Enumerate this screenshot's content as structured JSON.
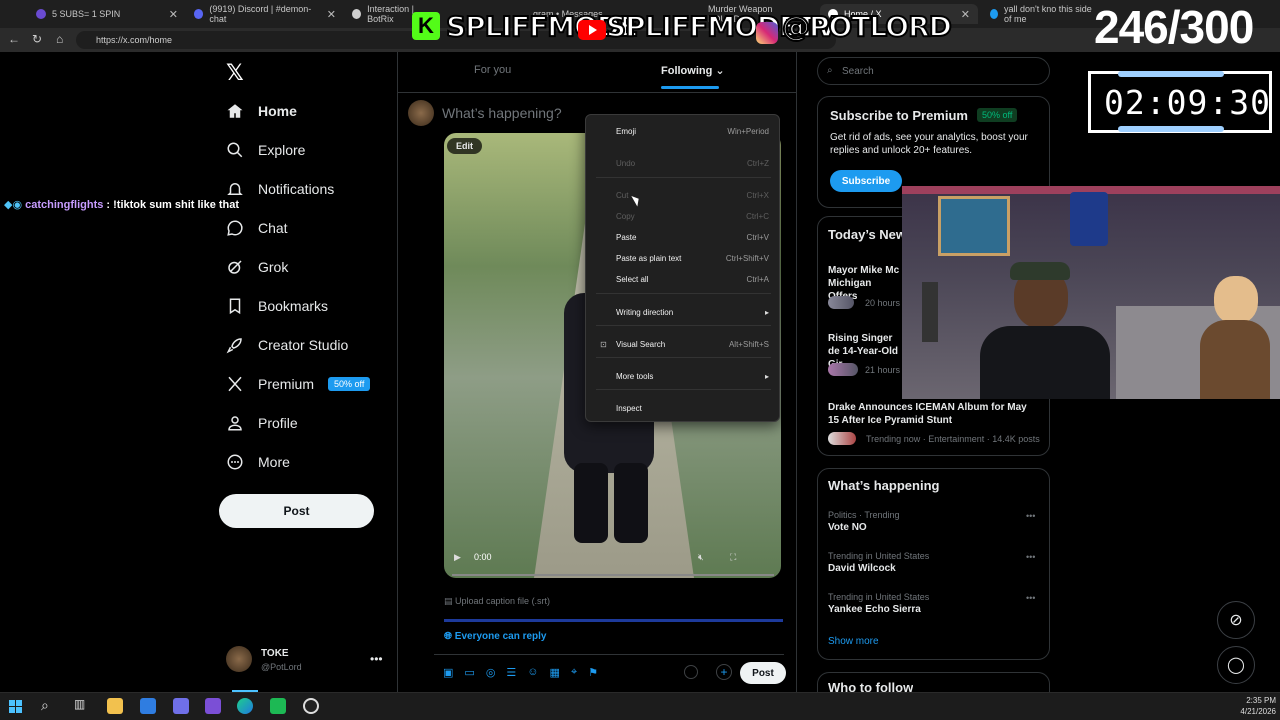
{
  "browser": {
    "tabs": [
      {
        "title": "5 SUBS= 1 SPIN",
        "fav_color": "#6a4bd1"
      },
      {
        "title": "(9919) Discord | #demon-chat",
        "fav_color": "#5865f2"
      },
      {
        "title": "Interaction | BotRix",
        "fav_color": "#cfcfcf"
      },
      {
        "title": "gram • Messages",
        "fav_color": "#d62976"
      },
      {
        "title": "Murder Weapon FOUND",
        "fav_color": "#ff0000"
      },
      {
        "title": "Home / X",
        "fav_color": "#ffffff"
      },
      {
        "title": "yall don't kno this side of me",
        "fav_color": "#1d9bf0"
      }
    ],
    "url": "https://x.com/home"
  },
  "overlay": {
    "counter": "246/300",
    "timer": "02:09:30",
    "banner_kick": "SPLIFFMODE",
    "banner_youtube": "SPLIFFMODETV",
    "banner_instagram": "@POTLORD",
    "chat_user": "catchingflights",
    "chat_msg": ": !tiktok sum shit like that"
  },
  "nav": {
    "items": [
      {
        "label": "Home",
        "icon": "home-icon"
      },
      {
        "label": "Explore",
        "icon": "search-icon"
      },
      {
        "label": "Notifications",
        "icon": "bell-icon"
      },
      {
        "label": "Chat",
        "icon": "chat-icon"
      },
      {
        "label": "Grok",
        "icon": "grok-icon"
      },
      {
        "label": "Bookmarks",
        "icon": "bookmark-icon"
      },
      {
        "label": "Creator Studio",
        "icon": "rocket-icon"
      },
      {
        "label": "Premium",
        "icon": "x-icon"
      },
      {
        "label": "Profile",
        "icon": "person-icon"
      },
      {
        "label": "More",
        "icon": "more-icon"
      }
    ],
    "premium_badge": "50% off",
    "post_label": "Post",
    "user_name": "TOKE",
    "user_handle": "@PotLord"
  },
  "feed": {
    "tab_for_you": "For you",
    "tab_following": "Following",
    "composer_placeholder": "What’s happening?",
    "edit_label": "Edit",
    "video_time": "0:00",
    "upload_caption": "Upload caption file (.srt)",
    "reply_setting": "Everyone can reply",
    "post_label": "Post"
  },
  "context_menu": [
    {
      "label": "Emoji",
      "shortcut": "Win+Period",
      "disabled": false
    },
    {
      "label": "Undo",
      "shortcut": "Ctrl+Z",
      "disabled": true
    },
    {
      "label": "Cut",
      "shortcut": "Ctrl+X",
      "disabled": true
    },
    {
      "label": "Copy",
      "shortcut": "Ctrl+C",
      "disabled": true
    },
    {
      "label": "Paste",
      "shortcut": "Ctrl+V",
      "disabled": false
    },
    {
      "label": "Paste as plain text",
      "shortcut": "Ctrl+Shift+V",
      "disabled": false
    },
    {
      "label": "Select all",
      "shortcut": "Ctrl+A",
      "disabled": false
    },
    {
      "label": "Writing direction",
      "shortcut": "",
      "disabled": false,
      "submenu": true
    },
    {
      "label": "Visual Search",
      "shortcut": "Alt+Shift+S",
      "disabled": false
    },
    {
      "label": "More tools",
      "shortcut": "",
      "disabled": false,
      "submenu": true
    },
    {
      "label": "Inspect",
      "shortcut": "",
      "disabled": false
    }
  ],
  "right": {
    "search_placeholder": "Search",
    "premium": {
      "title": "Subscribe to Premium",
      "badge": "50% off",
      "text": "Get rid of ads, see your analytics, boost your replies and unlock 20+ features.",
      "button": "Subscribe"
    },
    "news": {
      "title": "Today’s New",
      "items": [
        {
          "headline": "Mayor Mike Mc Michigan Offers",
          "meta": "20 hours"
        },
        {
          "headline": "Rising Singer de 14-Year-Old Gir",
          "meta": "21 hours"
        },
        {
          "headline": "Drake Announces ICEMAN Album for May 15 After Ice Pyramid Stunt",
          "meta": "Trending now · Entertainment · 14.4K posts"
        }
      ]
    },
    "happening": {
      "title": "What’s happening",
      "items": [
        {
          "context": "Politics · Trending",
          "topic": "Vote NO"
        },
        {
          "context": "Trending in United States",
          "topic": "David Wilcock"
        },
        {
          "context": "Trending in United States",
          "topic": "Yankee Echo Sierra"
        }
      ],
      "show_more": "Show more"
    },
    "who_to_follow": "Who to follow"
  },
  "taskbar": {
    "time": "2:35 PM",
    "date": "4/21/2026"
  }
}
